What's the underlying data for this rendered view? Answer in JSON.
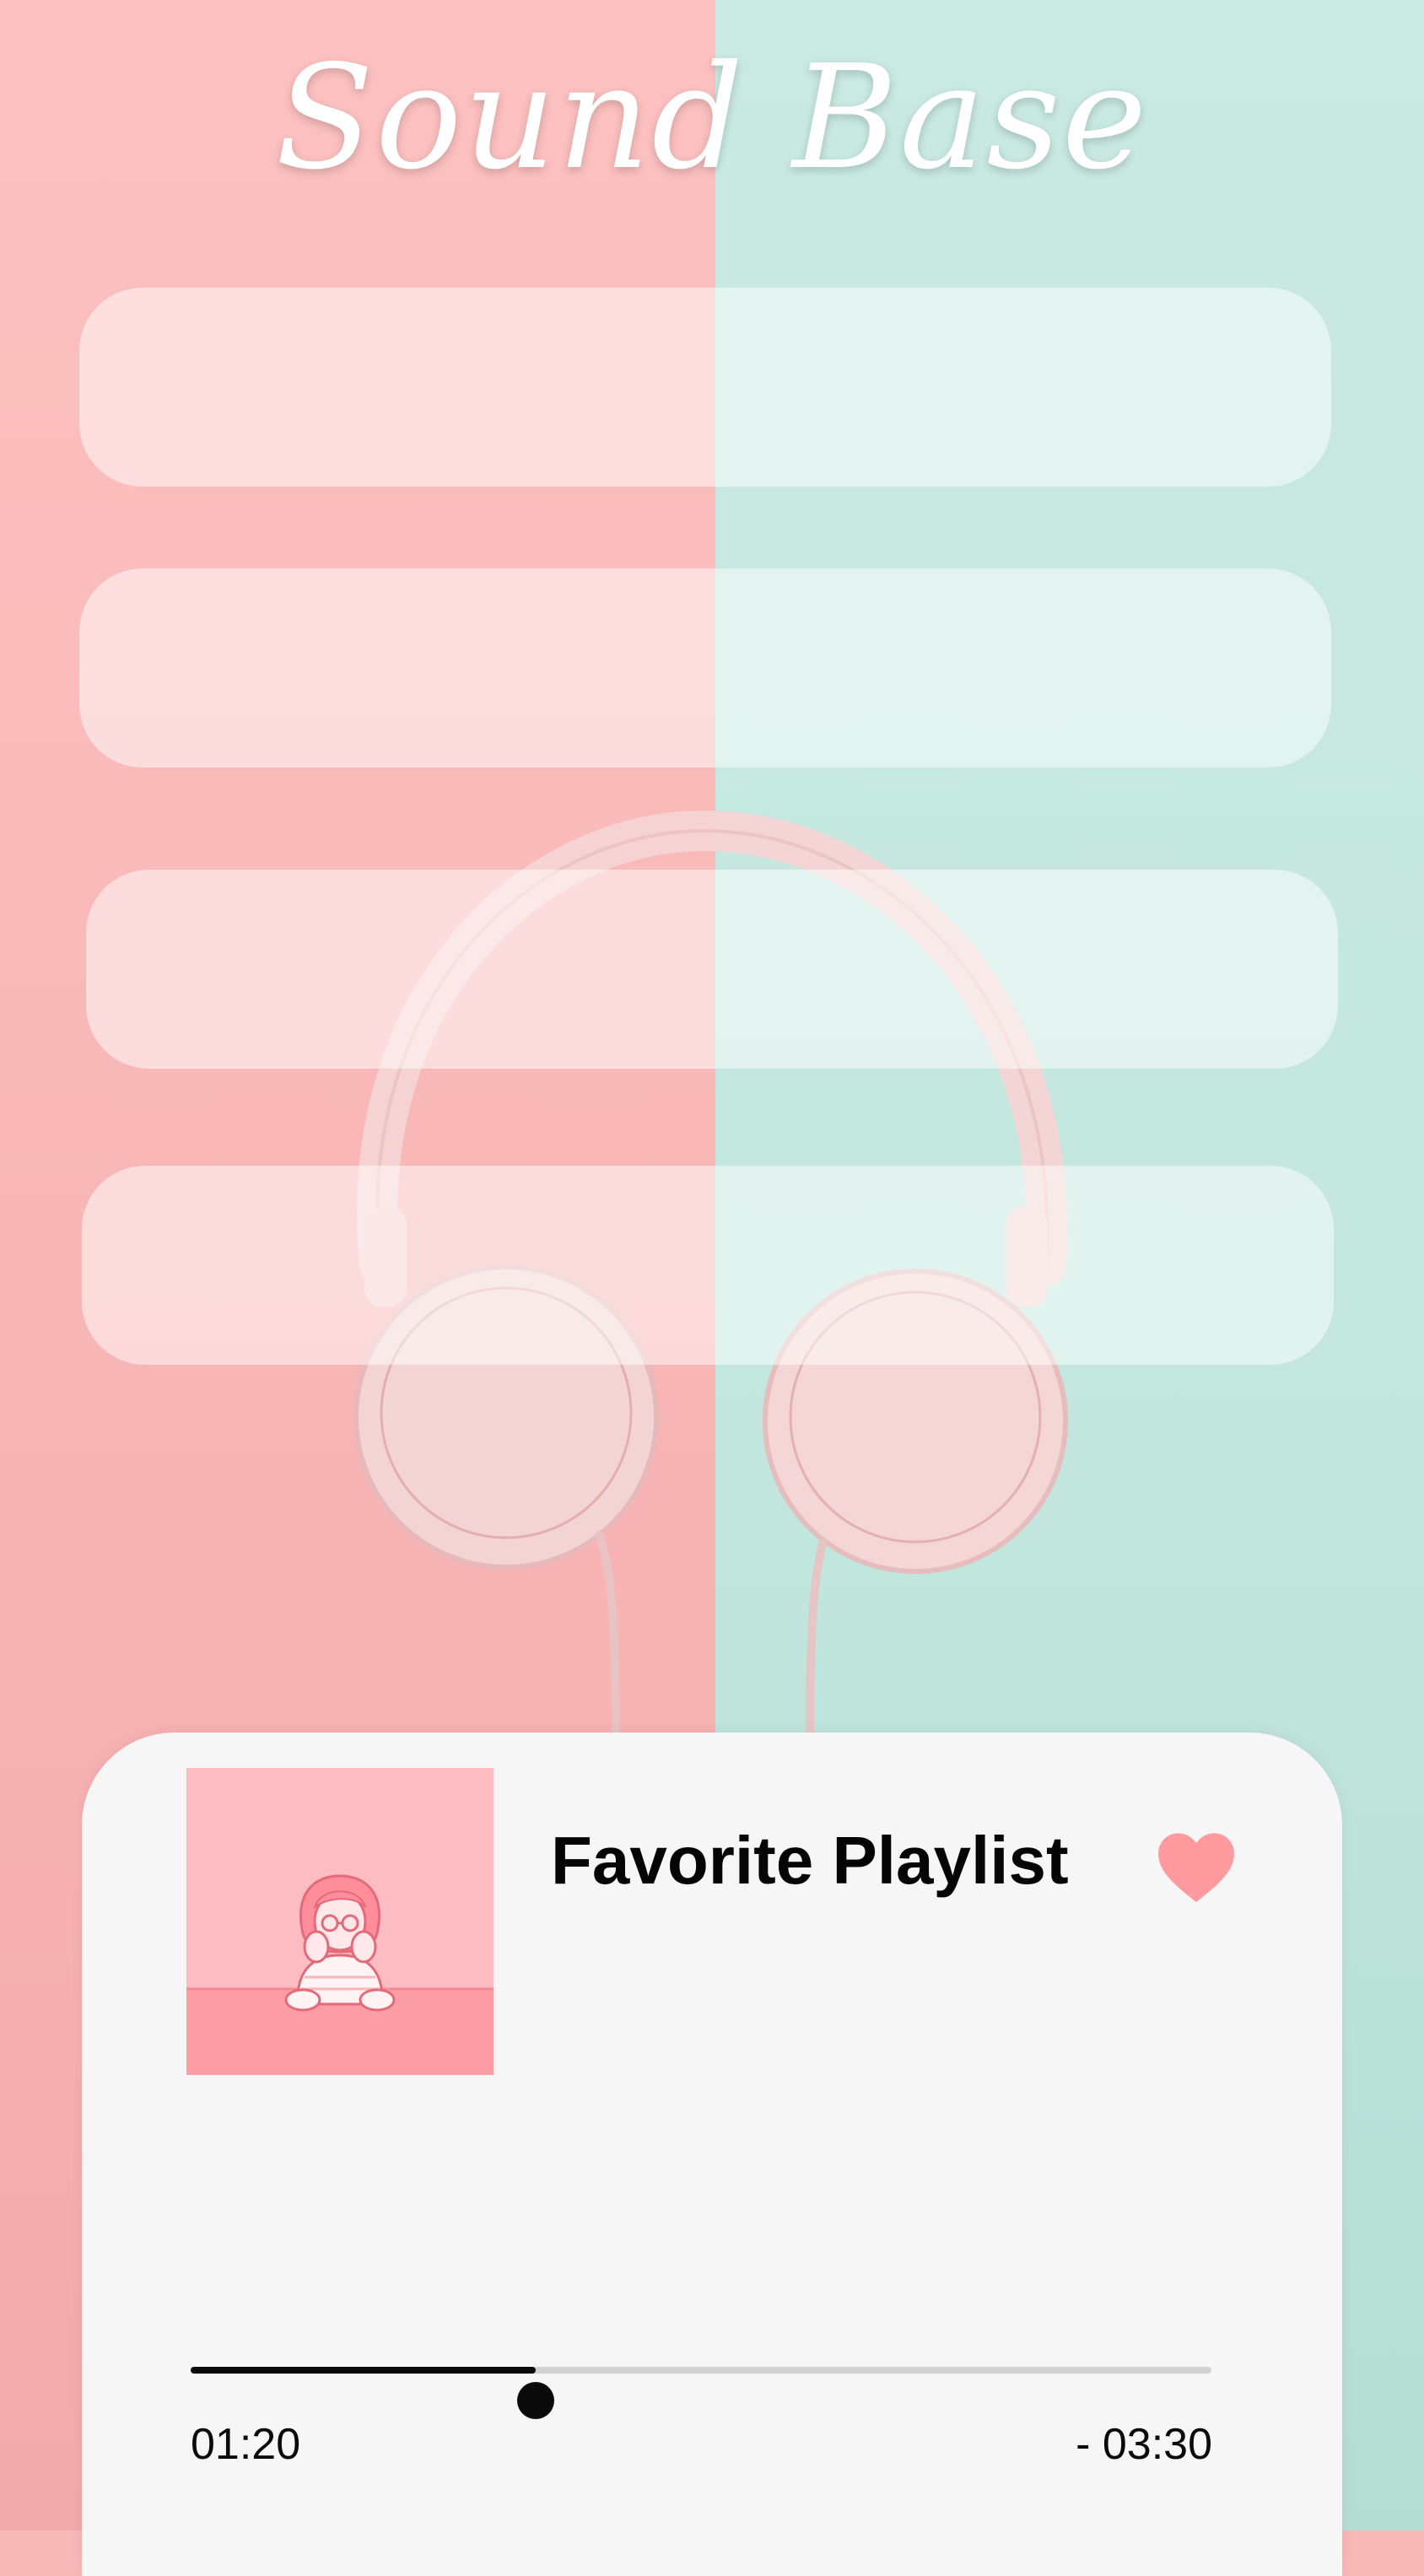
{
  "app": {
    "title": "Sound Base"
  },
  "playlist_rows": [
    {
      "label": ""
    },
    {
      "label": ""
    },
    {
      "label": ""
    },
    {
      "label": ""
    }
  ],
  "player": {
    "playlist_title": "Favorite Playlist",
    "favorite_icon": "heart-icon",
    "elapsed_time": "01:20",
    "remaining_time": "- 03:30",
    "progress_fraction": 0.338
  },
  "colors": {
    "background_left": "#fbc1c0",
    "background_right": "#c9e9e2",
    "card_background": "#f7f6f6",
    "heart": "#ff9a9e",
    "progress_played": "#0a0a0a",
    "progress_track": "#d2d2d2",
    "album_art_background": "#fdbcc2",
    "album_art_table": "#fd9ea6"
  }
}
